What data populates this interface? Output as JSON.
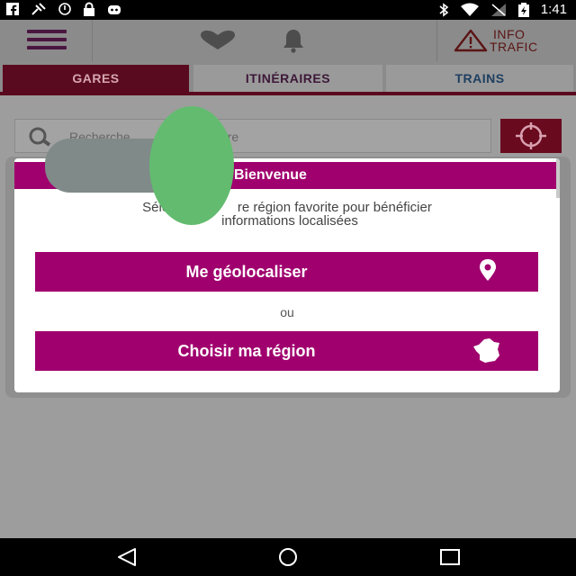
{
  "status_bar": {
    "left_icons": [
      "facebook-icon",
      "satellite-icon",
      "alarm-icon",
      "lock-icon",
      "android-icon"
    ],
    "right_icons": [
      "bluetooth-icon",
      "wifi-icon",
      "signal-icon",
      "battery-icon"
    ],
    "time": "1:41"
  },
  "header": {
    "info_line1": "INFO",
    "info_line2": "TRAFIC"
  },
  "tabs": [
    {
      "label": "GARES",
      "active": true
    },
    {
      "label": "ITINÉRAIRES",
      "active": false
    },
    {
      "label": "TRAINS",
      "active": false
    }
  ],
  "search": {
    "placeholder_visible": "Recherche",
    "placeholder_tail": "re"
  },
  "modal": {
    "title": "Bienvenue",
    "message_line1": "Sélection",
    "message_line1b": "re région favorite pour bénéficier",
    "message_line2": "informations localisées",
    "geolocate_label": "Me géolocaliser",
    "separator": "ou",
    "region_label": "Choisir ma région"
  },
  "colors": {
    "primary": "#a0006e",
    "tab_active": "#5a0a1e",
    "redaction_green": "#63bb6f",
    "redaction_gray": "#7f8a89"
  }
}
